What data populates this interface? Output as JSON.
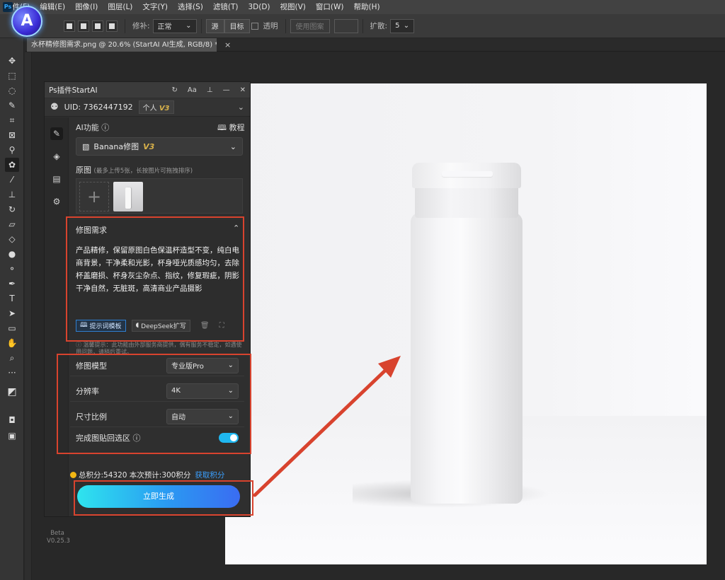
{
  "menubar": {
    "app_tag": "Ps",
    "items": [
      "文件(F)",
      "编辑(E)",
      "图像(I)",
      "图层(L)",
      "文字(Y)",
      "选择(S)",
      "滤镜(T)",
      "3D(D)",
      "视图(V)",
      "窗口(W)",
      "帮助(H)"
    ]
  },
  "logo": {
    "letter": "A"
  },
  "options_bar": {
    "feather_label": "修补:",
    "mode_value": "正常",
    "source_label": "源",
    "target_label": "目标",
    "transparent_label": "透明",
    "use_pattern_label": "使用图案",
    "diffusion_label": "扩散:",
    "diffusion_value": "5"
  },
  "document_tab": {
    "title": "水杯精修图需求.png @ 20.6% (StartAI AI生成, RGB/8) *",
    "close": "×"
  },
  "panel": {
    "title": "Ps插件StartAI",
    "uid": "UID: 7362447192",
    "account_type": "个人",
    "account_version": "V3",
    "ai_function_label": "AI功能 ⓘ",
    "tutorial_label": "教程",
    "function_select": "Banana修图",
    "function_version": "V3",
    "original_label": "原图",
    "original_hint": "(最多上传5张，长按图片可拖拽排序)",
    "request_title": "修图需求",
    "request_text": "产品精修，保留原图白色保温杯造型不变，纯白电商背景，干净柔和光影，杯身哑光质感均匀，去除杯盖磨损、杯身灰尘杂点、指纹，修复瑕疵，阴影干净自然，无脏斑，高清商业产品摄影",
    "prompt_template_button": "提示词模板",
    "deepseek_button": "DeepSeek扩写",
    "warning_text": "温馨提示：此功能由外部服务商提供，偶有服务不稳定，如遇使用问题，请稍后重试。",
    "params": [
      {
        "label": "修图模型",
        "value": "专业版Pro"
      },
      {
        "label": "分辨率",
        "value": "4K"
      },
      {
        "label": "尺寸比例",
        "value": "自动"
      }
    ],
    "paste_back_label": "完成图贴回选区 ⓘ",
    "paste_back_on": true,
    "points_text": "总积分:54320  本次预计:300积分",
    "get_points": "获取积分",
    "generate_button": "立即生成",
    "beta_label": "Beta",
    "version": "V0.25.3"
  },
  "colors": {
    "highlight": "#d8432e",
    "accent": "#1fb7f0",
    "gold": "#d8b14a"
  }
}
